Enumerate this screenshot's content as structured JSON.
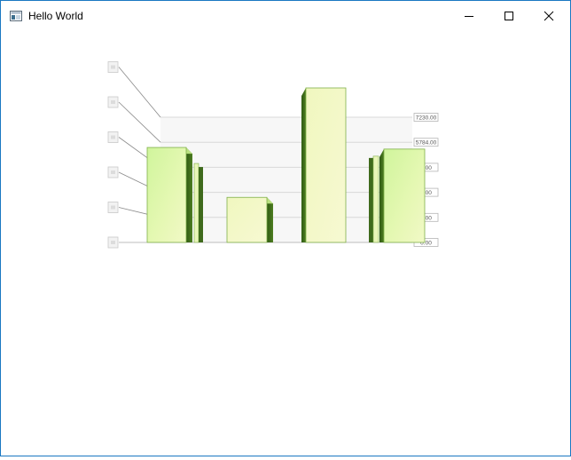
{
  "window": {
    "title": "Hello World",
    "controls": [
      "minimize",
      "maximize",
      "close"
    ],
    "icons": {
      "app": "app-window-icon",
      "minimize": "minimize-icon",
      "maximize": "maximize-icon",
      "close": "close-icon"
    }
  },
  "chart_data": {
    "type": "bar",
    "style": "3d",
    "grid": true,
    "ylim": [
      0,
      7230
    ],
    "right_axis_ticks": [
      {
        "value": 0,
        "label": "0.00"
      },
      {
        "value": 1446,
        "label": "6.00"
      },
      {
        "value": 2892,
        "label": "2.00"
      },
      {
        "value": 4338,
        "label": "8.00"
      },
      {
        "value": 5784,
        "label": "5784.00"
      },
      {
        "value": 7230,
        "label": "7230.00"
      }
    ],
    "values": [
      5900,
      2800,
      9600,
      5800
    ],
    "colors": {
      "bar_face_light": "#f4f8c6",
      "bar_face_green": "#cdf39a",
      "bar_side_dark": "#3f6a1c",
      "bar_outline": "#7fb04a",
      "grid": "#d8d8d8",
      "wall": "#f7f7f7"
    }
  }
}
